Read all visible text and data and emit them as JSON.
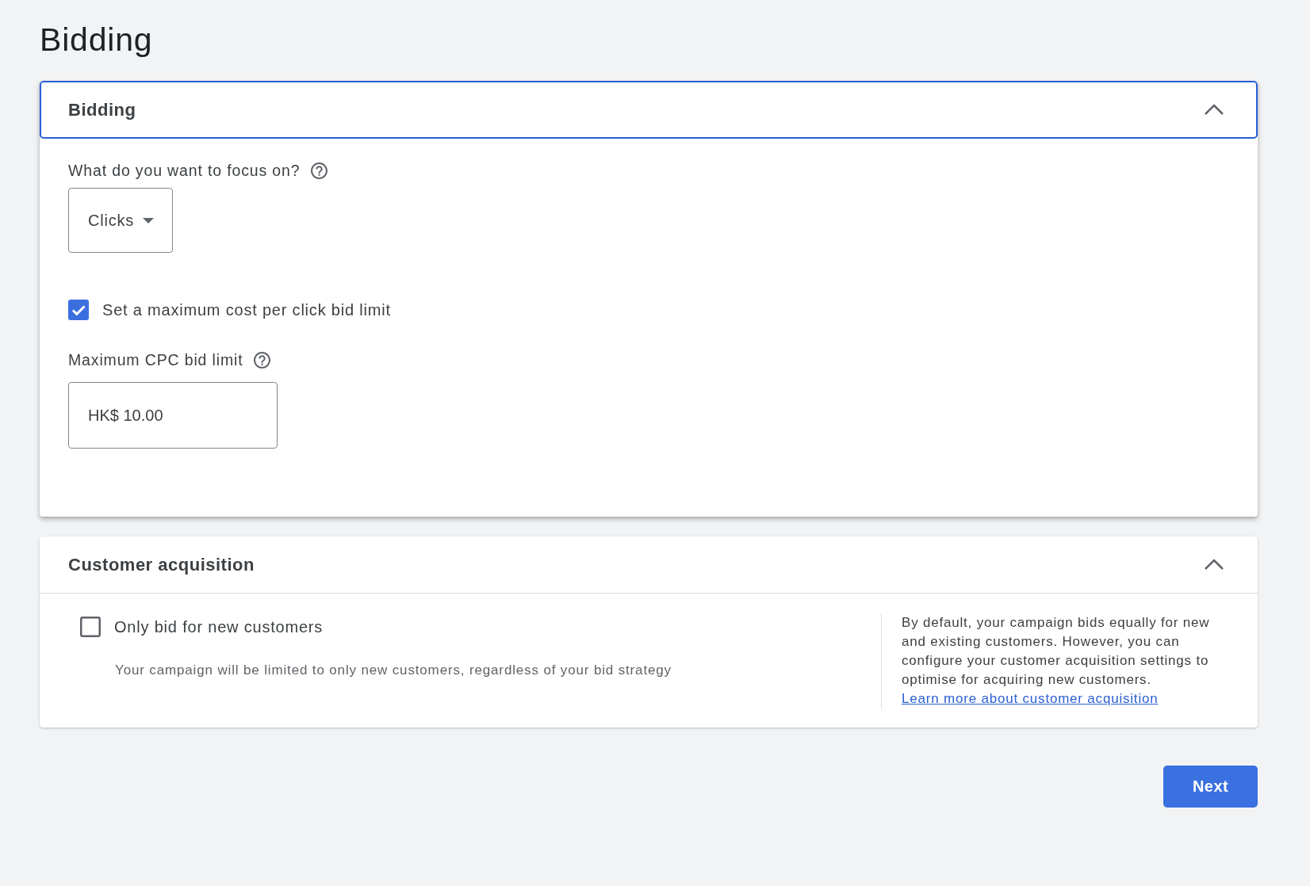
{
  "page": {
    "title": "Bidding"
  },
  "bidding_panel": {
    "title": "Bidding",
    "focused": true,
    "expanded": true,
    "focus_field": {
      "label": "What do you want to focus on?",
      "value": "Clicks"
    },
    "bid_limit_checkbox": {
      "label": "Set a maximum cost per click bid limit",
      "checked": true
    },
    "max_cpc_field": {
      "label": "Maximum CPC bid limit",
      "value": "HK$ 10.00"
    }
  },
  "customer_acquisition_panel": {
    "title": "Customer acquisition",
    "focused": false,
    "expanded": true,
    "new_customers_checkbox": {
      "label": "Only bid for new customers",
      "checked": false,
      "description": "Your campaign will be limited to only new customers, regardless of your bid strategy"
    },
    "info": {
      "text": "By default, your campaign bids equally for new and existing customers. However, you can configure your customer acquisition settings to optimise for acquiring new customers.",
      "link": "Learn more about customer acquisition"
    }
  },
  "next_button": {
    "label": "Next"
  }
}
